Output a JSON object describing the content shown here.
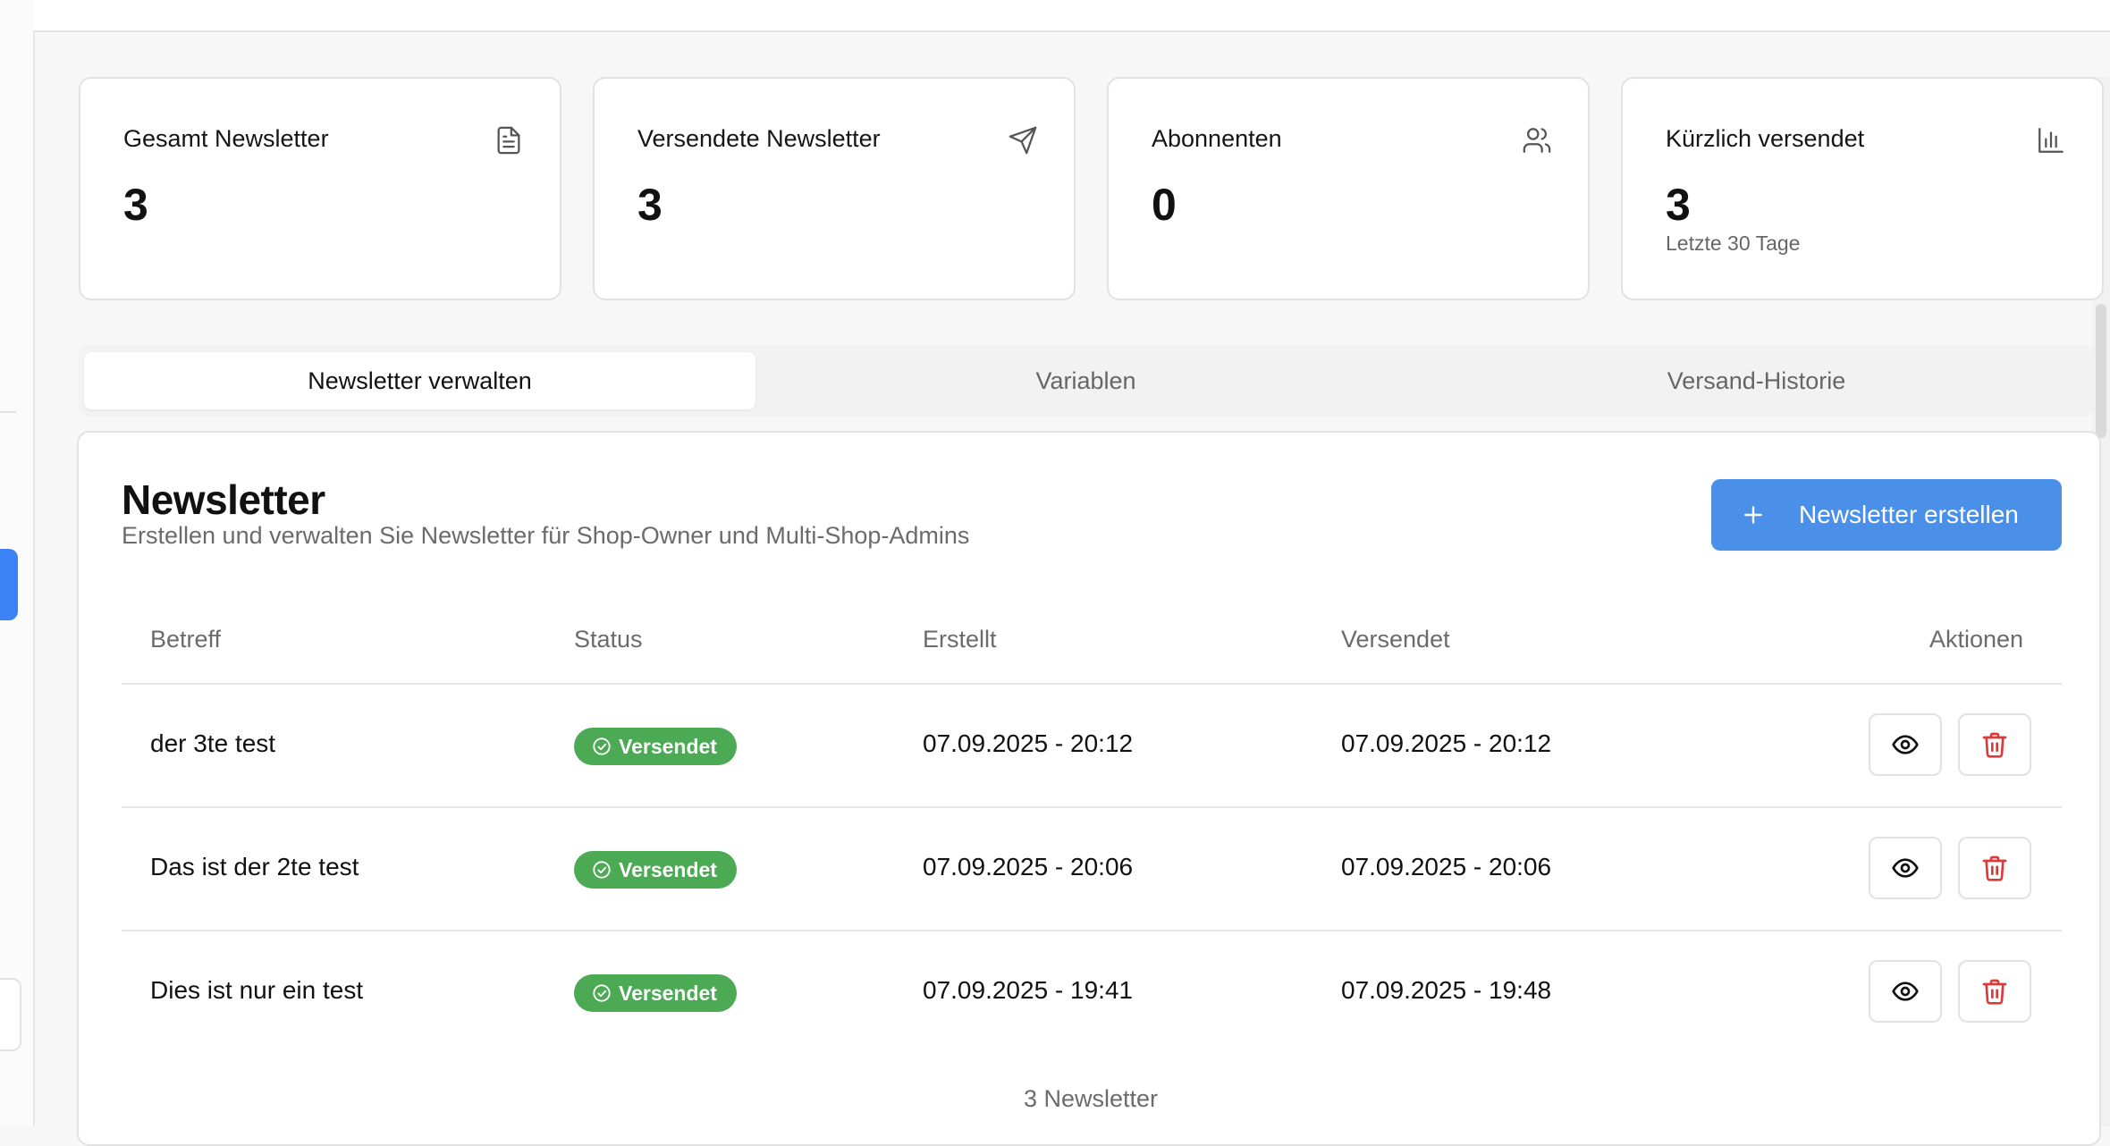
{
  "stats": [
    {
      "title": "Gesamt Newsletter",
      "value": "3",
      "sub": "",
      "icon": "document-icon"
    },
    {
      "title": "Versendete Newsletter",
      "value": "3",
      "sub": "",
      "icon": "send-icon"
    },
    {
      "title": "Abonnenten",
      "value": "0",
      "sub": "",
      "icon": "users-icon"
    },
    {
      "title": "Kürzlich versendet",
      "value": "3",
      "sub": "Letzte 30 Tage",
      "icon": "bar-chart-icon"
    }
  ],
  "tabs": [
    {
      "label": "Newsletter verwalten",
      "active": true
    },
    {
      "label": "Variablen",
      "active": false
    },
    {
      "label": "Versand-Historie",
      "active": false
    }
  ],
  "panel": {
    "title": "Newsletter",
    "description": "Erstellen und verwalten Sie Newsletter für Shop-Owner und Multi-Shop-Admins",
    "create_label": "Newsletter erstellen"
  },
  "table": {
    "headers": {
      "subject": "Betreff",
      "status": "Status",
      "created": "Erstellt",
      "sent": "Versendet",
      "actions": "Aktionen"
    },
    "rows": [
      {
        "subject": "der 3te test",
        "status": "Versendet",
        "created": "07.09.2025 - 20:12",
        "sent": "07.09.2025 - 20:12"
      },
      {
        "subject": "Das ist der 2te test",
        "status": "Versendet",
        "created": "07.09.2025 - 20:06",
        "sent": "07.09.2025 - 20:06"
      },
      {
        "subject": "Dies ist nur ein test",
        "status": "Versendet",
        "created": "07.09.2025 - 19:41",
        "sent": "07.09.2025 - 19:48"
      }
    ],
    "footer": "3 Newsletter"
  },
  "colors": {
    "accent": "#4a90e8",
    "success": "#4caa55",
    "danger": "#d93a3a"
  }
}
